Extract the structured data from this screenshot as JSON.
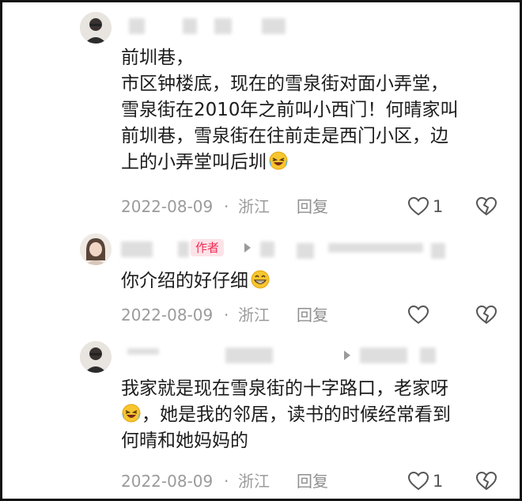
{
  "comments": [
    {
      "author_tag": "",
      "lines": [
        "前圳巷，",
        "市区钟楼底，现在的雪泉街对面小弄堂，",
        "雪泉街在2010年之前叫小西门！何晴家叫",
        "前圳巷，雪泉街在往前走是西门小区，边",
        "上的小弄堂叫后圳"
      ],
      "emoji": "laugh-cry-emoji",
      "date": "2022-08-09",
      "dot": "·",
      "region": "浙江",
      "reply": "回复",
      "like_count": "1"
    },
    {
      "author_tag": "作者",
      "lines": [
        "你介绍的好仔细"
      ],
      "emoji": "grin-emoji",
      "date": "2022-08-09",
      "dot": "·",
      "region": "浙江",
      "reply": "回复",
      "like_count": ""
    },
    {
      "author_tag": "",
      "lines": [
        "我家就是现在雪泉街的十字路口，老家呀",
        "，她是我的邻居，读书的时候经常看到",
        "何晴和她妈妈的"
      ],
      "emoji": "laugh-cry-emoji",
      "date": "2022-08-09",
      "dot": "·",
      "region": "浙江",
      "reply": "回复",
      "like_count": "1"
    }
  ],
  "colors": {
    "meta_gray": "#9b9b9b",
    "author_tag_bg": "#fde3e8",
    "author_tag_text": "#ee2c55",
    "text": "#1c1c1c"
  }
}
